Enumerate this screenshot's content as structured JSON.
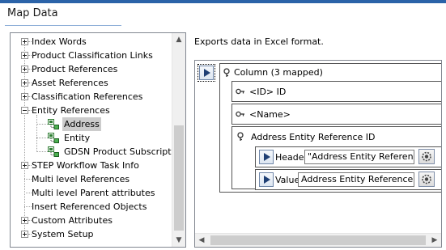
{
  "window": {
    "title": "Map Data"
  },
  "tree": {
    "items": [
      {
        "label": "Index Words",
        "expander": "plus"
      },
      {
        "label": "Product Classification Links",
        "expander": "plus"
      },
      {
        "label": "Product References",
        "expander": "plus"
      },
      {
        "label": "Asset References",
        "expander": "plus"
      },
      {
        "label": "Classification References",
        "expander": "plus"
      },
      {
        "label": "Entity References",
        "expander": "minus"
      },
      {
        "label": "Address",
        "child": true,
        "selected": true
      },
      {
        "label": "Entity",
        "child": true
      },
      {
        "label": "GDSN Product Subscription",
        "child": true
      },
      {
        "label": "STEP Workflow Task Info",
        "expander": "plus"
      },
      {
        "label": "Multi level References",
        "expander": "none"
      },
      {
        "label": "Multi level Parent attributes",
        "expander": "none"
      },
      {
        "label": "Insert Referenced Objects",
        "expander": "none"
      },
      {
        "label": "Custom Attributes",
        "expander": "plus"
      },
      {
        "label": "System Setup",
        "expander": "plus"
      }
    ]
  },
  "mapping": {
    "description": "Exports data in Excel format.",
    "column_label": "Column (3 mapped)",
    "id_row": "<ID> ID",
    "name_row": "<Name>",
    "attribute_row": "Address Entity Reference ID",
    "header": {
      "label": "Header",
      "value": "\"Address Entity Reference\""
    },
    "value": {
      "label": "Value",
      "value": "Address Entity Reference ID"
    }
  },
  "colors": {
    "accent": "#2b63a8",
    "selection": "#cccccc",
    "entity_icon": "#2e7d32"
  },
  "icons": [
    "key-icon",
    "gear-icon",
    "entity-icon",
    "play-icon",
    "chevron-up-icon",
    "chevron-down-icon",
    "chevron-left-icon",
    "chevron-right-icon"
  ]
}
